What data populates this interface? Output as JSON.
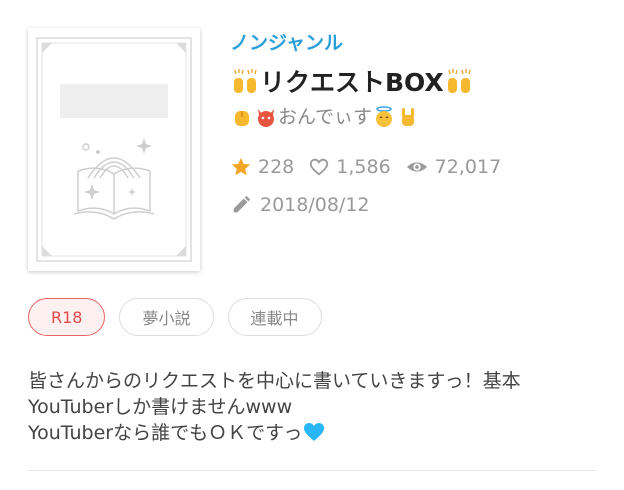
{
  "work": {
    "genre": "ノンジャンル",
    "title_text": "リクエストBOX",
    "title_icons": [
      "raising-hands-icon",
      "raising-hands-icon"
    ],
    "author_name": "おんでぃす",
    "author_icons": [
      "vulcan-salute-icon",
      "devil-face-icon",
      "angel-face-icon",
      "rock-on-hand-icon"
    ],
    "stats": {
      "stars": "228",
      "likes": "1,586",
      "views": "72,017"
    },
    "updated_date": "2018/08/12"
  },
  "tags": [
    "R18",
    "夢小説",
    "連載中"
  ],
  "description": {
    "line1": "皆さんからのリクエストを中心に書いていきますっ！基本",
    "line2": "YouTuberしか書けませんwww",
    "line3": "YouTuberなら誰でもＯＫですっ"
  },
  "colors": {
    "genre": "#2a9fd8",
    "star": "#f2a623",
    "r18_border": "#e86464",
    "heart_emoji": "#29b6f6"
  }
}
